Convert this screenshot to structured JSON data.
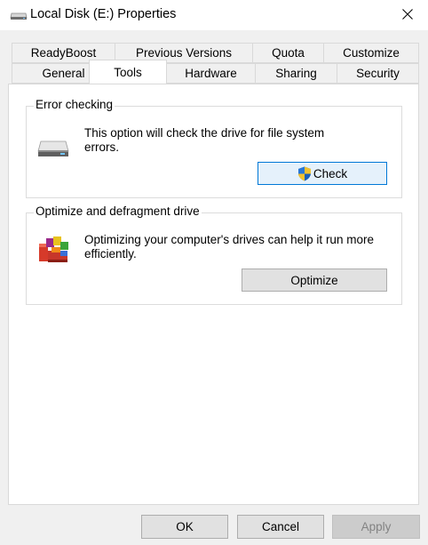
{
  "window": {
    "title": "Local Disk (E:) Properties",
    "icon": "drive-icon",
    "close_icon": "close-icon"
  },
  "tabs": {
    "row1": [
      "ReadyBoost",
      "Previous Versions",
      "Quota",
      "Customize"
    ],
    "row2": [
      "General",
      "Tools",
      "Hardware",
      "Sharing",
      "Security"
    ],
    "active": "Tools"
  },
  "error_checking": {
    "title": "Error checking",
    "description_line1": "This option will check the drive for file system",
    "description_line2": "errors.",
    "button_label": "Check",
    "button_icon": "uac-shield-icon",
    "icon": "hard-drive-icon"
  },
  "optimize": {
    "title": "Optimize and defragment drive",
    "description_line1": "Optimizing your computer's drives can help it run more",
    "description_line2": "efficiently.",
    "button_label": "Optimize",
    "icon": "defrag-icon"
  },
  "footer": {
    "ok_label": "OK",
    "cancel_label": "Cancel",
    "apply_label": "Apply"
  }
}
